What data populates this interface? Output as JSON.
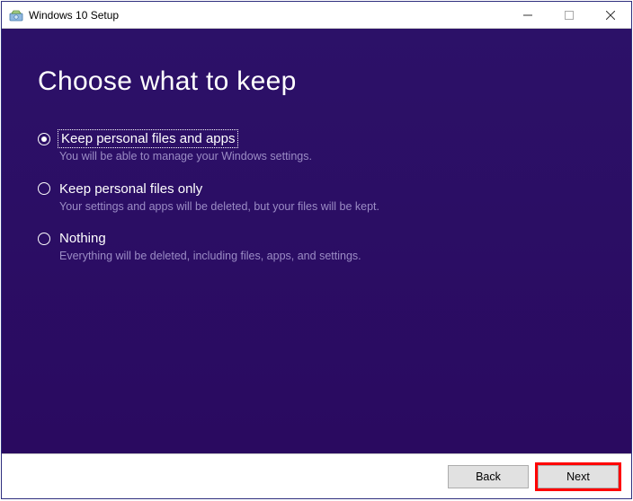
{
  "titlebar": {
    "title": "Windows 10 Setup"
  },
  "content": {
    "heading": "Choose what to keep",
    "options": [
      {
        "label": "Keep personal files and apps",
        "description": "You will be able to manage your Windows settings.",
        "selected": true,
        "focused": true
      },
      {
        "label": "Keep personal files only",
        "description": "Your settings and apps will be deleted, but your files will be kept.",
        "selected": false,
        "focused": false
      },
      {
        "label": "Nothing",
        "description": "Everything will be deleted, including files, apps, and settings.",
        "selected": false,
        "focused": false
      }
    ]
  },
  "footer": {
    "back": "Back",
    "next": "Next"
  }
}
